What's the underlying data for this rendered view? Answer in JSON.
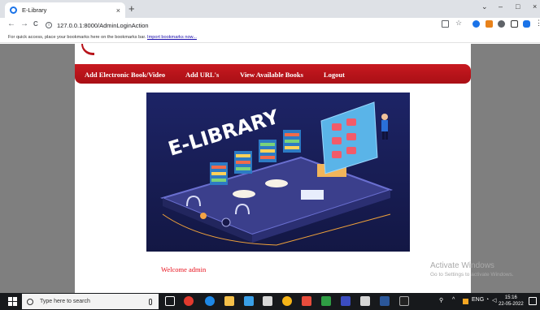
{
  "browser": {
    "tab_title": "E-Library",
    "tab_close": "×",
    "new_tab": "+",
    "back": "←",
    "forward": "→",
    "reload": "C",
    "url": "127.0.0.1:8000/AdminLoginAction",
    "bookmarks_text": "For quick access, place your bookmarks here on the bookmarks bar.",
    "bookmarks_link": "Import bookmarks now...",
    "minimize": "–",
    "maximize": "□",
    "close": "×"
  },
  "nav": {
    "items": [
      "Add Electronic Book/Video",
      "Add URL's",
      "View Available Books",
      "Logout"
    ]
  },
  "hero": {
    "title": "E-LIBRARY"
  },
  "welcome": "Welcome admin",
  "watermark": {
    "title": "Activate Windows",
    "subtitle": "Go to Settings to activate Windows."
  },
  "taskbar": {
    "search_placeholder": "Type here to search",
    "time": "15:16",
    "date": "22-05-2022",
    "lang": "ENG"
  },
  "colors": {
    "nav_red": "#c0141c",
    "welcome_red": "#e8101c",
    "hero_bg": "#1a1f5a"
  }
}
